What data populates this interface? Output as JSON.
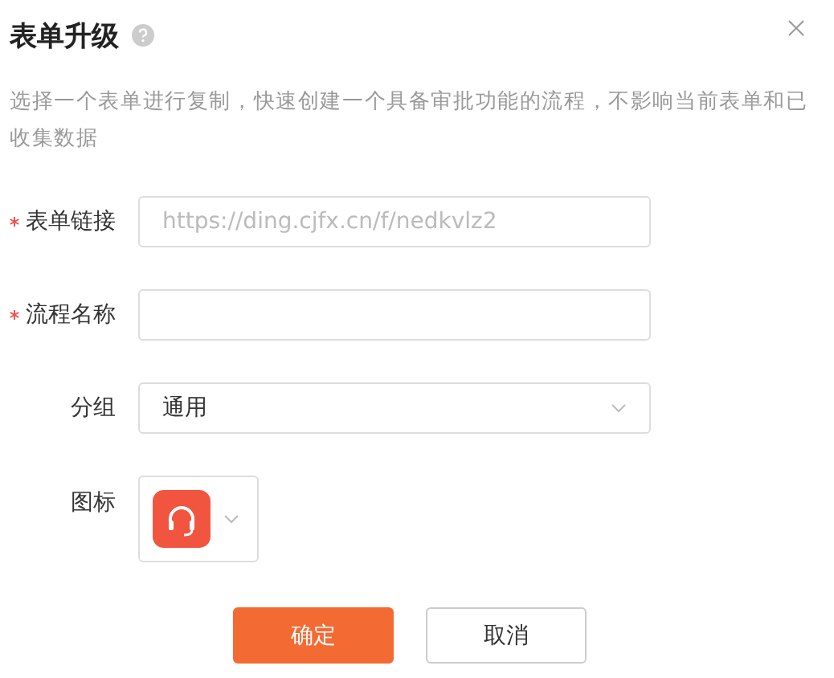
{
  "dialog": {
    "title": "表单升级",
    "description": "选择一个表单进行复制，快速创建一个具备审批功能的流程，不影响当前表单和已收集数据"
  },
  "fields": [
    {
      "kind": "text",
      "label": "表单链接",
      "required": true,
      "placeholder": "https://ding.cjfx.cn/f/nedkvlz2"
    },
    {
      "kind": "text",
      "label": "流程名称",
      "required": true
    },
    {
      "kind": "select",
      "label": "分组",
      "required": false,
      "value": "通用"
    },
    {
      "kind": "icon",
      "label": "图标",
      "required": false
    }
  ],
  "buttons": [
    {
      "label": "确定",
      "kind": "primary"
    },
    {
      "label": "取消",
      "kind": "default"
    }
  ]
}
